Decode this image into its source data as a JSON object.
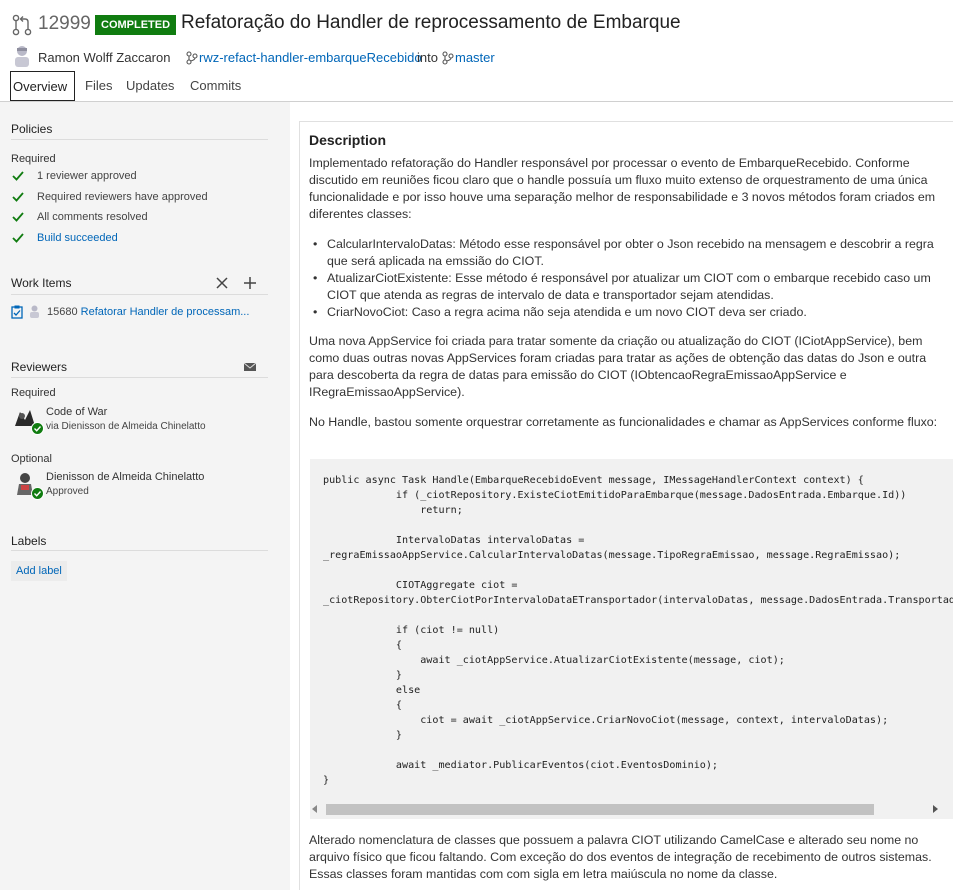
{
  "header": {
    "pr_id": "12999",
    "status": "COMPLETED",
    "title": "Refatoração do Handler de reprocessamento de Embarque",
    "author": "Ramon Wolff Zaccaron",
    "source_branch": "rwz-refact-handler-embarqueRecebido",
    "into": "into",
    "target_branch": "master"
  },
  "tabs": [
    {
      "label": "Overview"
    },
    {
      "label": "Files"
    },
    {
      "label": "Updates"
    },
    {
      "label": "Commits"
    }
  ],
  "sidebar": {
    "policies": {
      "title": "Policies",
      "required_label": "Required",
      "items": [
        {
          "label": "1 reviewer approved"
        },
        {
          "label": "Required reviewers have approved"
        },
        {
          "label": "All comments resolved"
        },
        {
          "label": "Build succeeded"
        }
      ]
    },
    "work_items": {
      "title": "Work Items",
      "item_id": "15680",
      "item_title": "Refatorar Handler de processam..."
    },
    "reviewers": {
      "title": "Reviewers",
      "required_label": "Required",
      "required": {
        "name": "Code of War",
        "via": "via Dienisson de Almeida Chinelatto"
      },
      "optional_label": "Optional",
      "optional": {
        "name": "Dienisson de Almeida Chinelatto",
        "status": "Approved"
      }
    },
    "labels": {
      "title": "Labels",
      "add_label": "Add label"
    }
  },
  "description": {
    "title": "Description",
    "intro": "Implementado refatoração do Handler responsável por processar o evento de EmbarqueRecebido. Conforme discutido em reuniões ficou claro que o handle possuía um fluxo muito extenso de orquestramento de uma única funcionalidade e por isso houve uma separação melhor de responsabilidade e 3 novos métodos foram criados em diferentes classes:",
    "bullets": [
      "CalcularIntervaloDatas: Método esse responsável por obter o Json recebido na mensagem e descobrir a regra que será aplicada na emssião do CIOT.",
      "AtualizarCiotExistente: Esse método é responsável por atualizar um CIOT com o embarque recebido caso um CIOT que atenda as regras de intervalo de data e transportador sejam atendidas.",
      "CriarNovoCiot: Caso a regra acima não seja atendida e um novo CIOT deva ser criado."
    ],
    "appservice_para": "Uma nova AppService foi criada para tratar somente da criação ou atualização do CIOT (ICiotAppService), bem como duas outras novas AppServices foram criadas para tratar as ações de obtenção das datas do Json e outra para descoberta da regra de datas para emissão do CIOT (IObtencaoRegraEmissaoAppService e IRegraEmissaoAppService).",
    "handle_para": "No Handle, bastou somente orquestrar corretamente as funcionalidades e chamar as AppServices conforme fluxo:",
    "code": "public async Task Handle(EmbarqueRecebidoEvent message, IMessageHandlerContext context) {\n            if (_ciotRepository.ExisteCiotEmitidoParaEmbarque(message.DadosEntrada.Embarque.Id))\n                return;\n\n            IntervaloDatas intervaloDatas =\n_regraEmissaoAppService.CalcularIntervaloDatas(message.TipoRegraEmissao, message.RegraEmissao);\n\n            CIOTAggregate ciot =\n_ciotRepository.ObterCiotPorIntervaloDataETransportador(intervaloDatas, message.DadosEntrada.Transportador.Id);\n\n            if (ciot != null)\n            {\n                await _ciotAppService.AtualizarCiotExistente(message, ciot);\n            }\n            else\n            {\n                ciot = await _ciotAppService.CriarNovoCiot(message, context, intervaloDatas);\n            }\n\n            await _mediator.PublicarEventos(ciot.EventosDominio);\n}",
    "footer_para": "Alterado nomenclatura de classes que possuem a palavra CIOT utilizando CamelCase e alterado seu nome no arquivo físico que ficou faltando. Com exceção do dos eventos de integração de recebimento de outros sistemas. Essas classes foram mantidas com com sigla em letra maiúscula no nome da classe."
  },
  "colors": {
    "accent": "#0066b8",
    "completed": "#107c10",
    "check": "#107c10"
  }
}
